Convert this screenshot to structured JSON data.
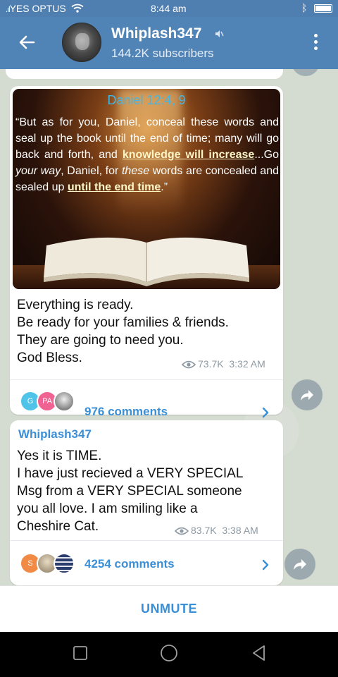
{
  "status_bar": {
    "carrier": "YES OPTUS",
    "time": "8:44 am"
  },
  "header": {
    "title": "Whiplash347",
    "subtitle": "144.2K subscribers"
  },
  "posts": [
    {
      "image": {
        "reference": "Daniel 12:4, 9",
        "verse_parts": [
          "“But as for you, Daniel, conceal these words and seal up the book until the end of time; many will go back and forth, and ",
          "knowledge will increase",
          "...Go ",
          "your way",
          ", Daniel, for ",
          "these",
          " words are concealed and sealed up ",
          "until the end time",
          ".”"
        ]
      },
      "text_lines": [
        "Everything is ready.",
        "Be ready for your families & friends.",
        "They are going to need you.",
        "God Bless."
      ],
      "views": "73.7K",
      "time": "3:32 AM",
      "avatars": [
        {
          "label": "G",
          "color": "#4fc3e8"
        },
        {
          "label": "PA",
          "color": "#f06292"
        },
        {
          "label": "",
          "color": "#9e9e9e"
        }
      ],
      "comments": "976 comments"
    },
    {
      "sender": "Whiplash347",
      "text_lines": [
        "Yes it is TIME.",
        "I have just recieved a VERY SPECIAL",
        "Msg from a VERY SPECIAL someone",
        "you all love. I am smiling like a",
        "Cheshire Cat."
      ],
      "views": "83.7K",
      "time": "3:38 AM",
      "avatars": [
        {
          "label": "S",
          "color": "#f08a45"
        },
        {
          "label": "",
          "color": "#c9b89a"
        },
        {
          "label": "",
          "color": "#2c3e6e"
        }
      ],
      "comments": "4254 comments"
    }
  ],
  "bottom_bar": {
    "unmute_label": "UNMUTE"
  },
  "colors": {
    "appbar": "#5184b6",
    "link": "#3a8fd6",
    "meta": "#8e9aa4"
  },
  "icons": [
    "wifi-icon",
    "bluetooth-icon",
    "battery-icon",
    "back-arrow-icon",
    "muted-icon",
    "more-vert-icon",
    "eye-icon",
    "chevron-right-icon",
    "share-icon",
    "square-nav-icon",
    "circle-nav-icon",
    "triangle-back-nav-icon"
  ]
}
